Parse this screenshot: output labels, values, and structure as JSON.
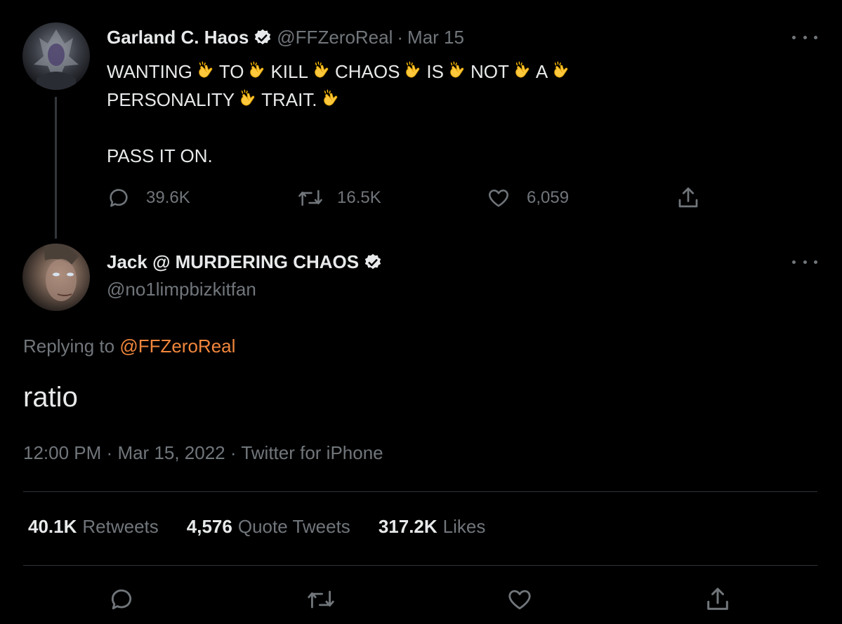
{
  "parent_tweet": {
    "author_name": "Garland C. Haos",
    "handle": "@FFZeroReal",
    "separator": "·",
    "date": "Mar 15",
    "text_words_line1": [
      "WANTING",
      "TO",
      "KILL",
      "CHAOS",
      "IS",
      "NOT",
      "A"
    ],
    "text_words_line2": [
      "PERSONALITY",
      "TRAIT."
    ],
    "text_line3": "PASS IT ON.",
    "replies": "39.6K",
    "retweets": "16.5K",
    "likes": "6,059"
  },
  "reply_tweet": {
    "author_name": "Jack @ MURDERING CHAOS",
    "handle": "@no1limpbizkitfan",
    "replying_prefix": "Replying to",
    "replying_mention": "@FFZeroReal",
    "text": "ratio",
    "time": "12:00 PM",
    "date": "Mar 15, 2022",
    "source": "Twitter for iPhone",
    "separator": "·",
    "stats": {
      "retweets_count": "40.1K",
      "retweets_label": "Retweets",
      "quotes_count": "4,576",
      "quotes_label": "Quote Tweets",
      "likes_count": "317.2K",
      "likes_label": "Likes"
    }
  },
  "colors": {
    "background": "#000000",
    "text_primary": "#e7e9ea",
    "text_secondary": "#71767b",
    "mention": "#f2863c",
    "divider": "#2f3336"
  },
  "icons": {
    "verified": "verified-badge-icon",
    "clap": "clapping-hands-emoji",
    "reply": "reply-icon",
    "retweet": "retweet-icon",
    "like": "heart-icon",
    "share": "share-icon",
    "more": "more-options-icon"
  }
}
